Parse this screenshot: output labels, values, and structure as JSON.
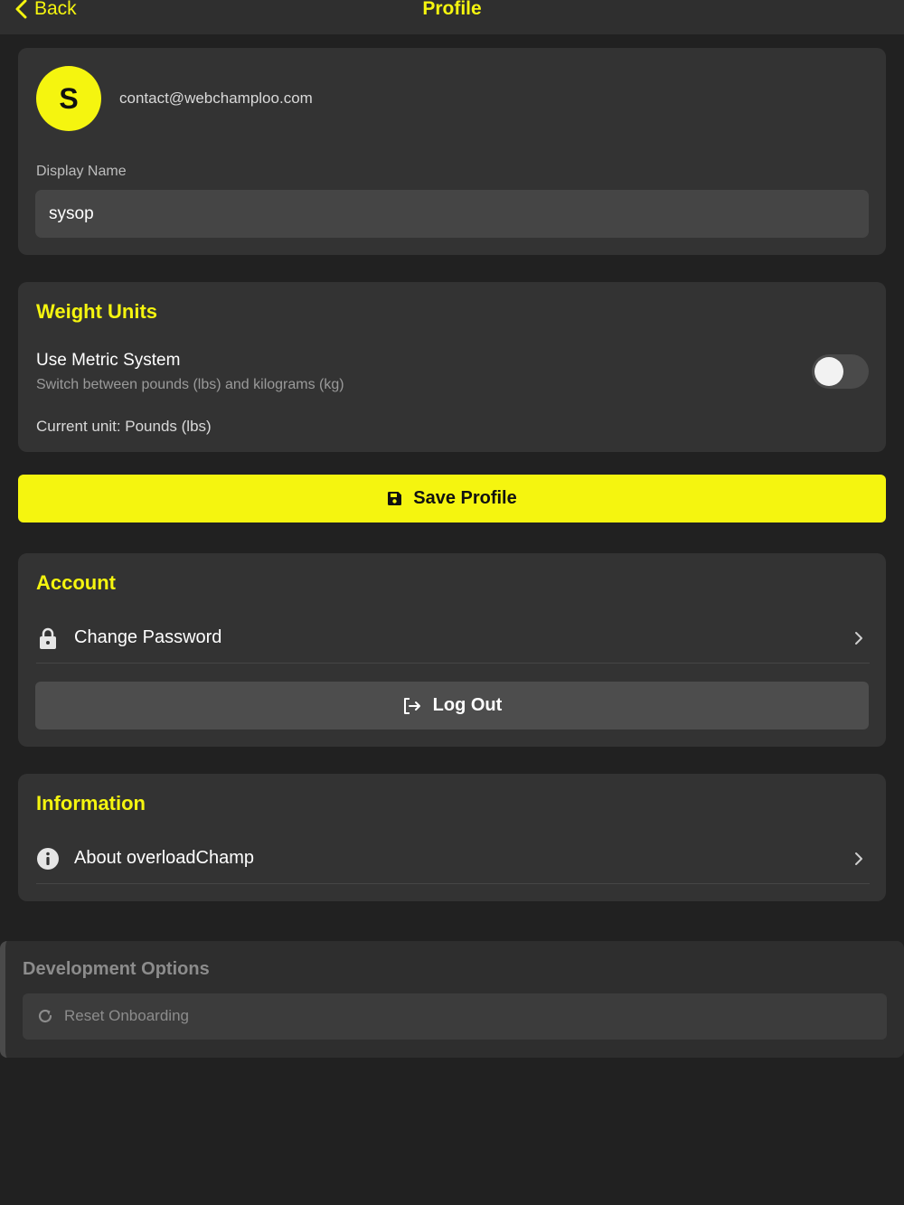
{
  "nav": {
    "back_label": "Back",
    "title": "Profile"
  },
  "profile": {
    "avatar_initial": "S",
    "email": "contact@webchamploo.com",
    "display_name_label": "Display Name",
    "display_name_value": "sysop"
  },
  "weight_units": {
    "title": "Weight Units",
    "setting_label": "Use Metric System",
    "setting_description": "Switch between pounds (lbs) and kilograms (kg)",
    "metric_enabled": false,
    "current_unit": "Current unit: Pounds (lbs)"
  },
  "save_button": {
    "label": "Save Profile",
    "icon": "floppy-disk-icon"
  },
  "account": {
    "title": "Account",
    "change_password_label": "Change Password",
    "change_password_icon": "lock-icon",
    "logout_label": "Log Out",
    "logout_icon": "logout-icon"
  },
  "information": {
    "title": "Information",
    "about_label": "About overloadChamp",
    "about_icon": "info-icon"
  },
  "dev_options": {
    "title": "Development Options",
    "reset_label": "Reset Onboarding",
    "reset_icon": "refresh-icon"
  },
  "colors": {
    "accent": "#f5f50f",
    "background": "#212121",
    "card": "#333333"
  }
}
